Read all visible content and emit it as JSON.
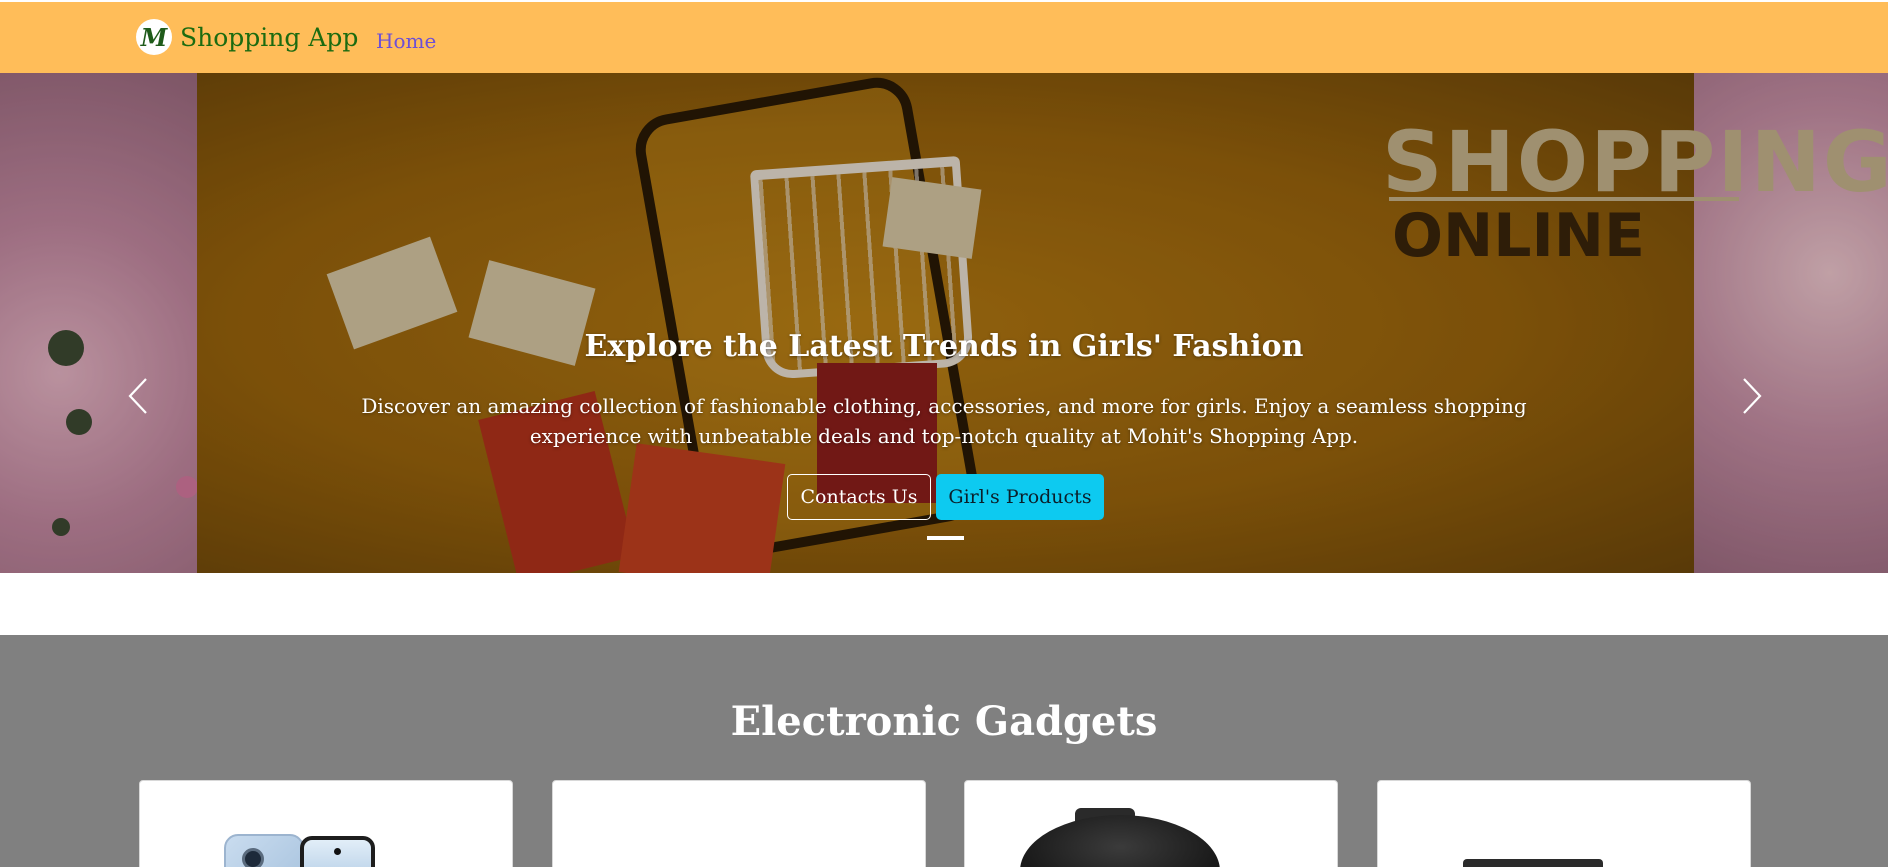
{
  "navbar": {
    "brand_logo_letter": "M",
    "brand_name": "Shopping App",
    "links": [
      {
        "label": "Home"
      }
    ],
    "background": "#ffbd59"
  },
  "hero": {
    "background_words": {
      "shopping": "SHOPPING",
      "online": "ONLINE"
    },
    "title": "Explore the Latest Trends in Girls' Fashion",
    "description": "Discover an amazing collection of fashionable clothing, accessories, and more for girls. Enjoy a seamless shopping experience with unbeatable deals and top-notch quality at Mohit's Shopping App.",
    "buttons": {
      "contacts": "Contacts Us",
      "girls_products": "Girl's Products"
    },
    "indicator_count": 1,
    "active_indicator": 1,
    "prev_icon": "chevron-left-icon",
    "next_icon": "chevron-right-icon"
  },
  "gadgets": {
    "title": "Electronic Gadgets",
    "background": "#808080",
    "cards": [
      {
        "image": "smartphone"
      },
      {
        "image": "blank"
      },
      {
        "image": "camera"
      },
      {
        "image": "device-box"
      }
    ]
  }
}
